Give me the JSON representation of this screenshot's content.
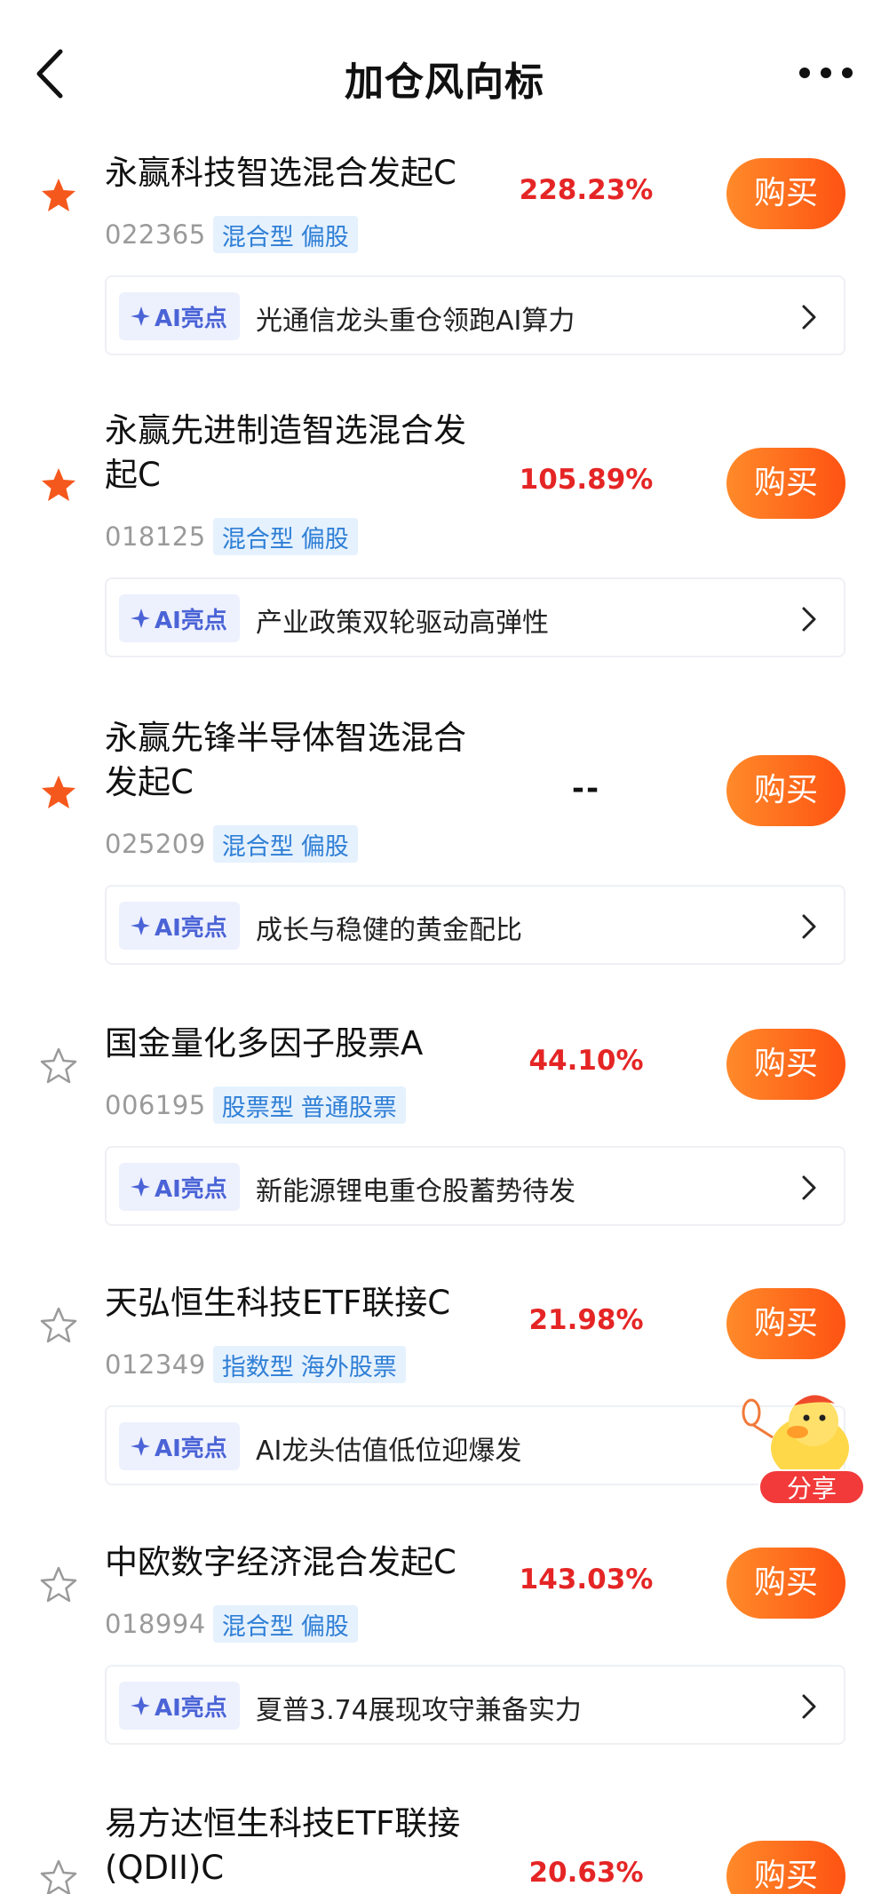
{
  "header": {
    "title": "加仓风向标",
    "back_icon": "chevron-left-icon",
    "more_icon": "more-horizontal-icon"
  },
  "buy_label": "购买",
  "ai_badge_label": "AI亮点",
  "colors": {
    "accent_orange": "#fe5312",
    "return_red": "#e52525",
    "tag_blue": "#2f7fd6",
    "star_filled": "#f5581c"
  },
  "funds": [
    {
      "name_lines": [
        "永赢科技智选混合发起C"
      ],
      "code": "022365",
      "tags": [
        "混合型",
        "偏股"
      ],
      "return": "228.23%",
      "starred": true,
      "ai_text": "光通信龙头重仓领跑AI算力"
    },
    {
      "name_lines": [
        "永赢先进制造智选混合发",
        "起C"
      ],
      "code": "018125",
      "tags": [
        "混合型",
        "偏股"
      ],
      "return": "105.89%",
      "starred": true,
      "ai_text": "产业政策双轮驱动高弹性"
    },
    {
      "name_lines": [
        "永赢先锋半导体智选混合",
        "发起C"
      ],
      "code": "025209",
      "tags": [
        "混合型",
        "偏股"
      ],
      "return": "--",
      "starred": true,
      "ai_text": "成长与稳健的黄金配比"
    },
    {
      "name_lines": [
        "国金量化多因子股票A"
      ],
      "code": "006195",
      "tags": [
        "股票型",
        "普通股票"
      ],
      "return": "44.10%",
      "starred": false,
      "ai_text": "新能源锂电重仓股蓄势待发"
    },
    {
      "name_lines": [
        "天弘恒生科技ETF联接C"
      ],
      "code": "012349",
      "tags": [
        "指数型",
        "海外股票"
      ],
      "return": "21.98%",
      "starred": false,
      "ai_text": "AI龙头估值低位迎爆发"
    },
    {
      "name_lines": [
        "中欧数字经济混合发起C"
      ],
      "code": "018994",
      "tags": [
        "混合型",
        "偏股"
      ],
      "return": "143.03%",
      "starred": false,
      "ai_text": "夏普3.74展现攻守兼备实力"
    },
    {
      "name_lines": [
        "易方达恒生科技ETF联接",
        "(QDII)C"
      ],
      "code": "",
      "tags": [],
      "return": "20.63%",
      "starred": false,
      "ai_text": ""
    }
  ],
  "share": {
    "label": "分享",
    "icon": "duck-mascot-icon"
  }
}
